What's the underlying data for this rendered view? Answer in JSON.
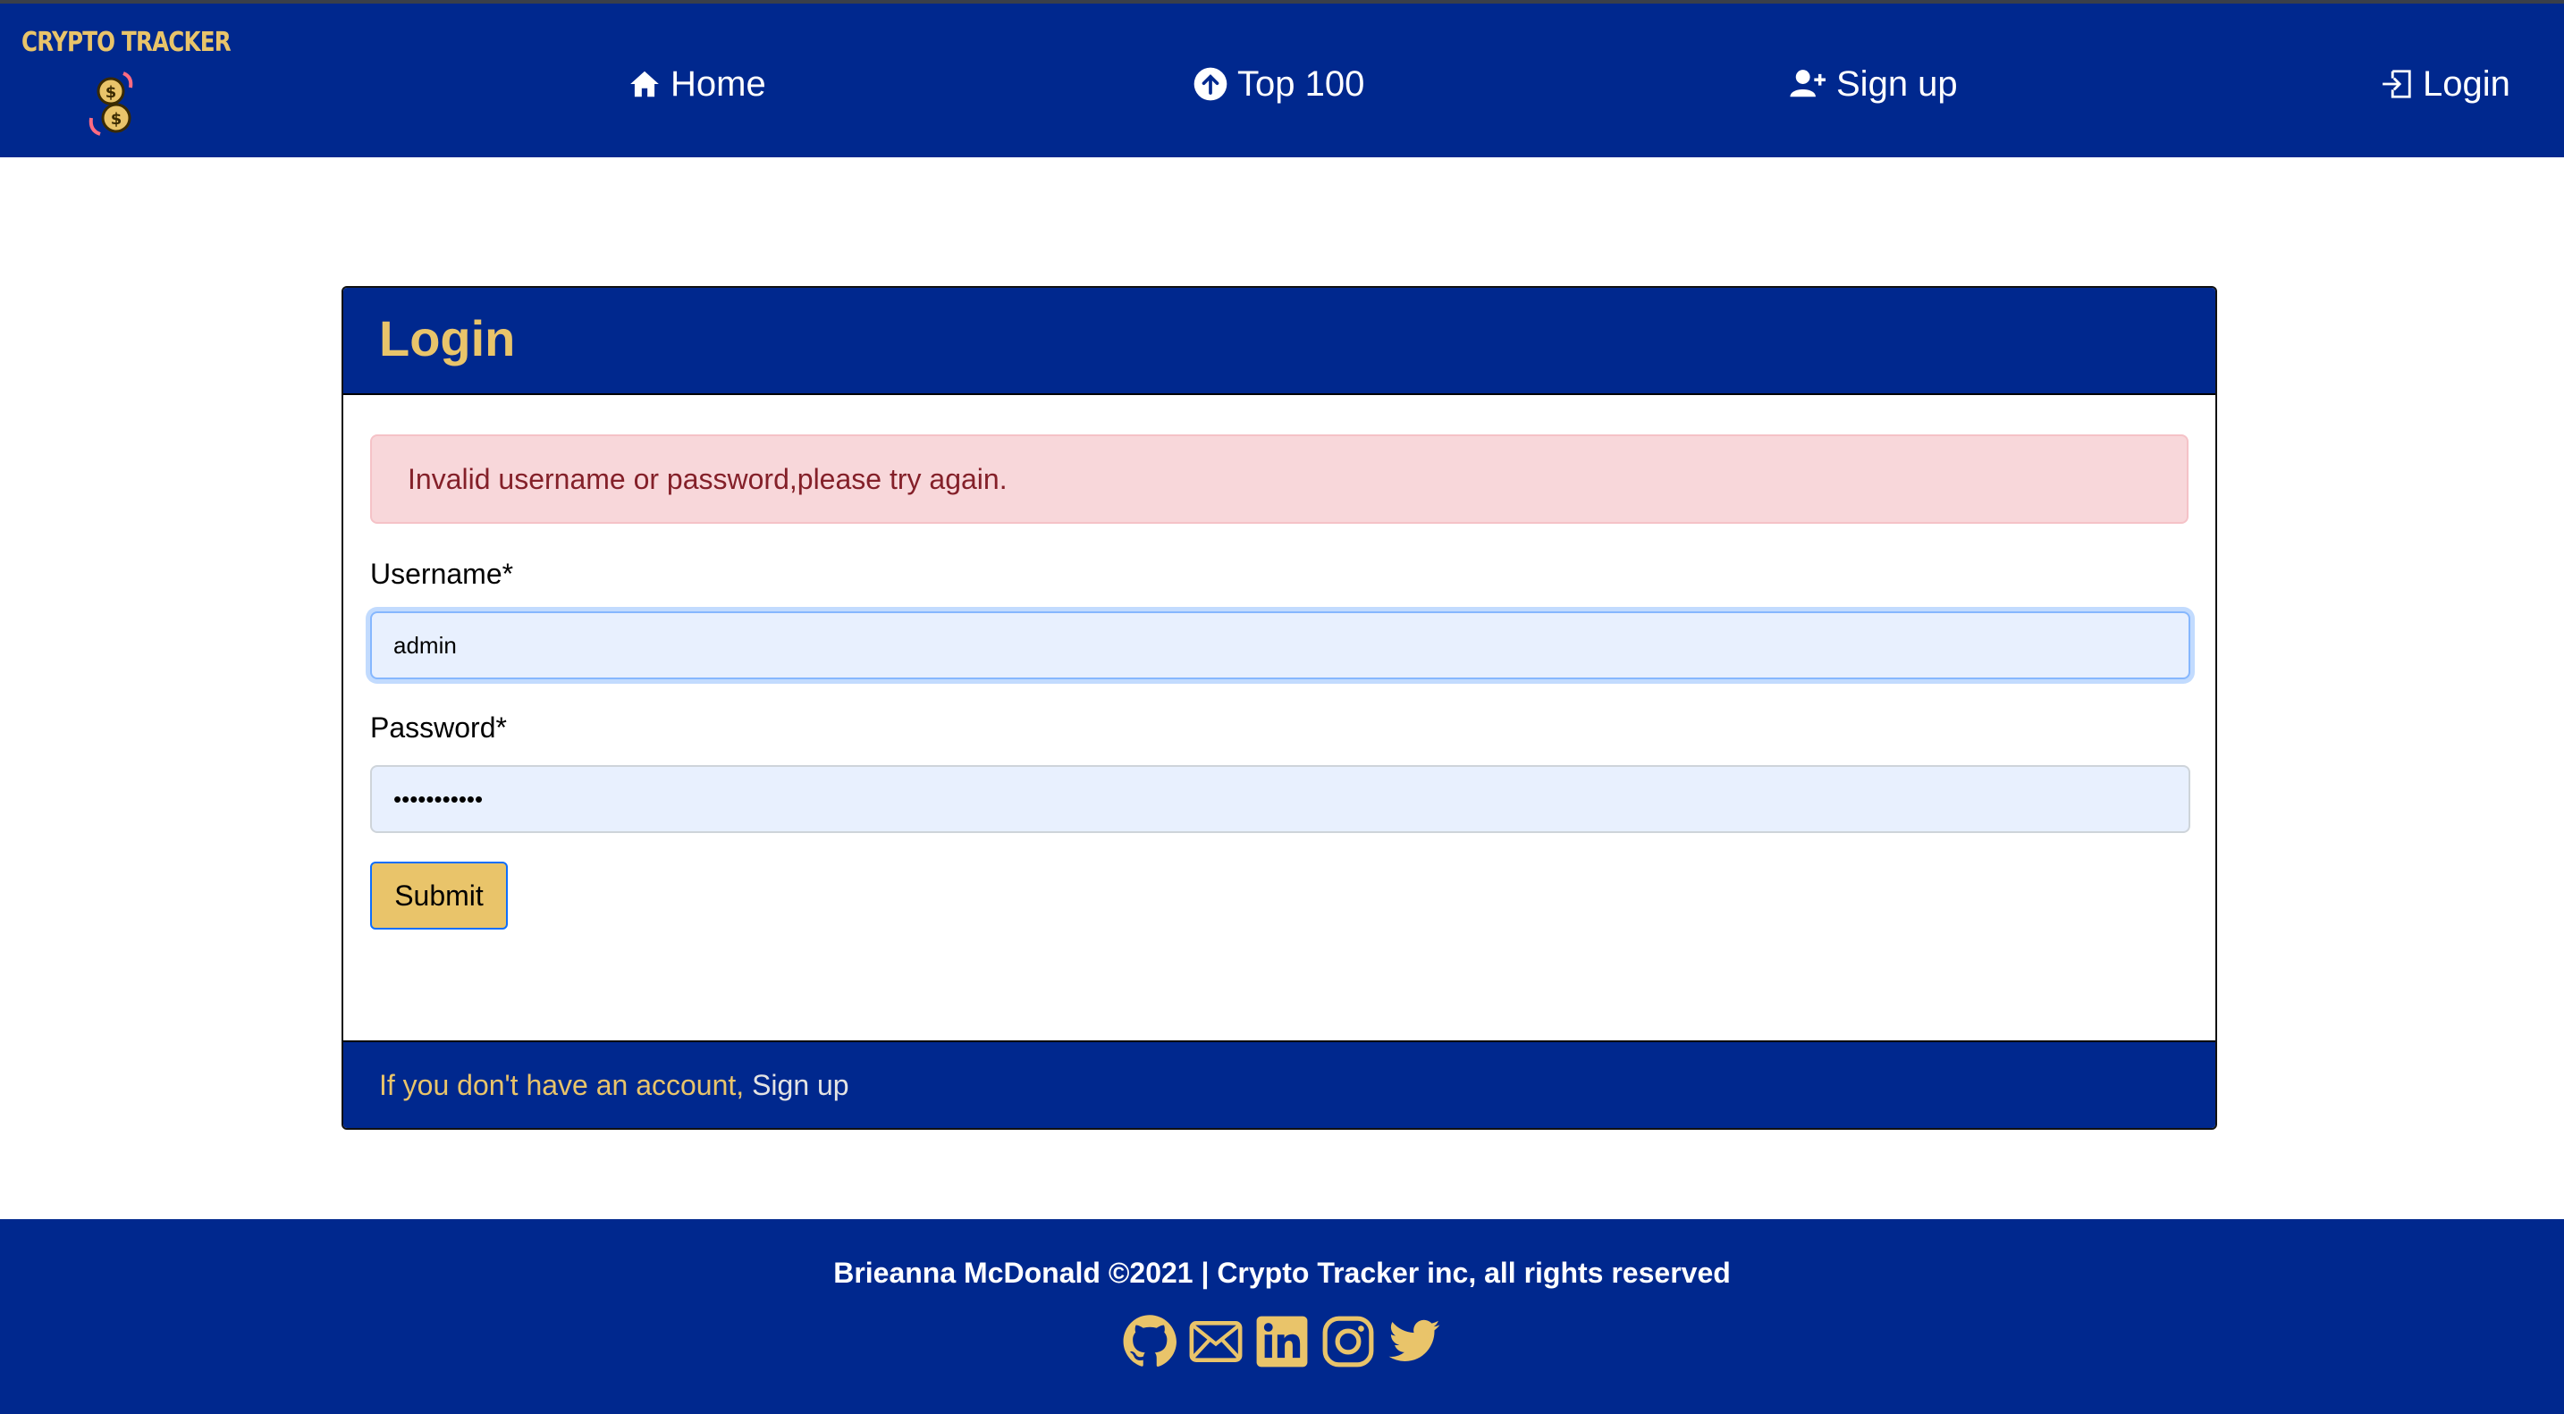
{
  "brand": {
    "name": "CRYPTO TRACKER",
    "logo_icon": "coins-icon"
  },
  "nav": {
    "items": [
      {
        "label": "Home",
        "icon": "house-icon"
      },
      {
        "label": "Top 100",
        "icon": "arrow-up-circle-icon"
      },
      {
        "label": "Sign up",
        "icon": "person-plus-icon"
      },
      {
        "label": "Login",
        "icon": "box-arrow-in-right-icon"
      }
    ]
  },
  "login_card": {
    "title": "Login",
    "error_message": "Invalid username or password,please try again.",
    "username_label": "Username*",
    "username_value": "admin",
    "password_label": "Password*",
    "password_value": "•••••••••••",
    "submit_label": "Submit",
    "footer_prompt": "If you don't have an account,",
    "footer_link": "Sign up"
  },
  "footer": {
    "copyright": "Brieanna McDonald ©2021 | Crypto Tracker inc, all rights reserved",
    "socials": [
      "github-icon",
      "envelope-icon",
      "linkedin-icon",
      "instagram-icon",
      "twitter-icon"
    ]
  },
  "colors": {
    "navy": "#00288e",
    "gold": "#e9c46a",
    "alert_bg": "#f8d7da",
    "alert_text": "#842029",
    "input_bg": "#e8f0fe"
  }
}
